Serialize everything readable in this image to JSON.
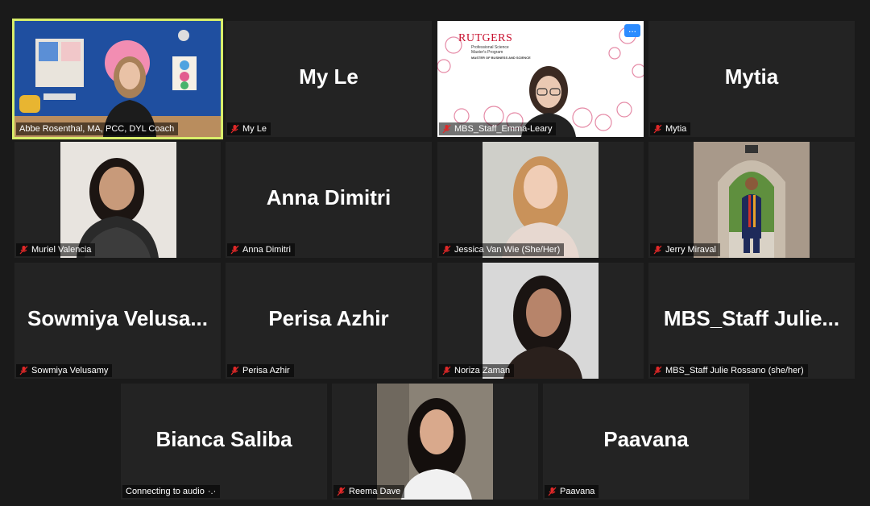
{
  "meeting": {
    "tiles": [
      {
        "display_name": "",
        "label": "Abbe Rosenthal, MA, PCC, DYL Coach"
      },
      {
        "display_name": "My Le",
        "label": "My Le"
      },
      {
        "display_name": "",
        "label": "MBS_Staff_Emma-Leary"
      },
      {
        "display_name": "Mytia",
        "label": "Mytia"
      },
      {
        "display_name": "",
        "label": "Muriel Valencia"
      },
      {
        "display_name": "Anna Dimitri",
        "label": "Anna Dimitri"
      },
      {
        "display_name": "",
        "label": "Jessica Van Wie (She/Her)"
      },
      {
        "display_name": "",
        "label": "Jerry Miraval"
      },
      {
        "display_name": "Sowmiya  Velusa...",
        "label": "Sowmiya Velusamy"
      },
      {
        "display_name": "Perisa Azhir",
        "label": "Perisa Azhir"
      },
      {
        "display_name": "",
        "label": "Noriza Zaman"
      },
      {
        "display_name": "MBS_Staff  Julie...",
        "label": "MBS_Staff Julie Rossano (she/her)"
      },
      {
        "display_name": "Bianca Saliba",
        "label": "Connecting to audio"
      },
      {
        "display_name": "",
        "label": "Reema Dave"
      },
      {
        "display_name": "Paavana",
        "label": "Paavana"
      }
    ],
    "shared_slide": {
      "logo_text": "RUTGERS",
      "line1": "Professional Science",
      "line2": "Master's Program",
      "line3": "MASTER OF BUSINESS AND SCIENCE"
    },
    "more_button": "...",
    "connecting_indicator": "·.·"
  },
  "colors": {
    "background": "#1a1a1a",
    "tile": "#232323",
    "active_speaker_border": "#d8ee6a",
    "mute_icon": "#e02828",
    "accent": "#2d8cff"
  }
}
